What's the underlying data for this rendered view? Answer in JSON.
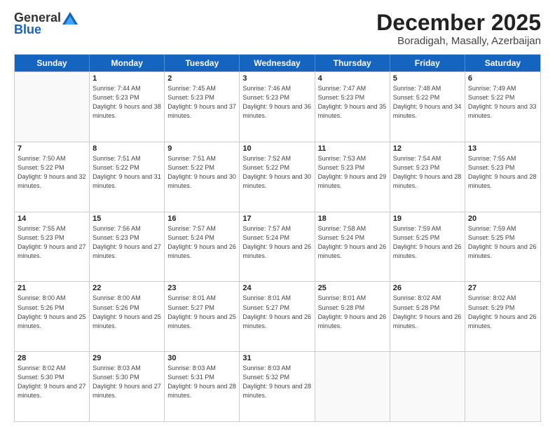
{
  "logo": {
    "general": "General",
    "blue": "Blue"
  },
  "header": {
    "month": "December 2025",
    "location": "Boradigah, Masally, Azerbaijan"
  },
  "weekdays": [
    "Sunday",
    "Monday",
    "Tuesday",
    "Wednesday",
    "Thursday",
    "Friday",
    "Saturday"
  ],
  "weeks": [
    [
      {
        "day": "",
        "empty": true
      },
      {
        "day": "1",
        "sunrise": "Sunrise: 7:44 AM",
        "sunset": "Sunset: 5:23 PM",
        "daylight": "Daylight: 9 hours and 38 minutes."
      },
      {
        "day": "2",
        "sunrise": "Sunrise: 7:45 AM",
        "sunset": "Sunset: 5:23 PM",
        "daylight": "Daylight: 9 hours and 37 minutes."
      },
      {
        "day": "3",
        "sunrise": "Sunrise: 7:46 AM",
        "sunset": "Sunset: 5:23 PM",
        "daylight": "Daylight: 9 hours and 36 minutes."
      },
      {
        "day": "4",
        "sunrise": "Sunrise: 7:47 AM",
        "sunset": "Sunset: 5:23 PM",
        "daylight": "Daylight: 9 hours and 35 minutes."
      },
      {
        "day": "5",
        "sunrise": "Sunrise: 7:48 AM",
        "sunset": "Sunset: 5:22 PM",
        "daylight": "Daylight: 9 hours and 34 minutes."
      },
      {
        "day": "6",
        "sunrise": "Sunrise: 7:49 AM",
        "sunset": "Sunset: 5:22 PM",
        "daylight": "Daylight: 9 hours and 33 minutes."
      }
    ],
    [
      {
        "day": "7",
        "sunrise": "Sunrise: 7:50 AM",
        "sunset": "Sunset: 5:22 PM",
        "daylight": "Daylight: 9 hours and 32 minutes."
      },
      {
        "day": "8",
        "sunrise": "Sunrise: 7:51 AM",
        "sunset": "Sunset: 5:22 PM",
        "daylight": "Daylight: 9 hours and 31 minutes."
      },
      {
        "day": "9",
        "sunrise": "Sunrise: 7:51 AM",
        "sunset": "Sunset: 5:22 PM",
        "daylight": "Daylight: 9 hours and 30 minutes."
      },
      {
        "day": "10",
        "sunrise": "Sunrise: 7:52 AM",
        "sunset": "Sunset: 5:22 PM",
        "daylight": "Daylight: 9 hours and 30 minutes."
      },
      {
        "day": "11",
        "sunrise": "Sunrise: 7:53 AM",
        "sunset": "Sunset: 5:23 PM",
        "daylight": "Daylight: 9 hours and 29 minutes."
      },
      {
        "day": "12",
        "sunrise": "Sunrise: 7:54 AM",
        "sunset": "Sunset: 5:23 PM",
        "daylight": "Daylight: 9 hours and 28 minutes."
      },
      {
        "day": "13",
        "sunrise": "Sunrise: 7:55 AM",
        "sunset": "Sunset: 5:23 PM",
        "daylight": "Daylight: 9 hours and 28 minutes."
      }
    ],
    [
      {
        "day": "14",
        "sunrise": "Sunrise: 7:55 AM",
        "sunset": "Sunset: 5:23 PM",
        "daylight": "Daylight: 9 hours and 27 minutes."
      },
      {
        "day": "15",
        "sunrise": "Sunrise: 7:56 AM",
        "sunset": "Sunset: 5:23 PM",
        "daylight": "Daylight: 9 hours and 27 minutes."
      },
      {
        "day": "16",
        "sunrise": "Sunrise: 7:57 AM",
        "sunset": "Sunset: 5:24 PM",
        "daylight": "Daylight: 9 hours and 26 minutes."
      },
      {
        "day": "17",
        "sunrise": "Sunrise: 7:57 AM",
        "sunset": "Sunset: 5:24 PM",
        "daylight": "Daylight: 9 hours and 26 minutes."
      },
      {
        "day": "18",
        "sunrise": "Sunrise: 7:58 AM",
        "sunset": "Sunset: 5:24 PM",
        "daylight": "Daylight: 9 hours and 26 minutes."
      },
      {
        "day": "19",
        "sunrise": "Sunrise: 7:59 AM",
        "sunset": "Sunset: 5:25 PM",
        "daylight": "Daylight: 9 hours and 26 minutes."
      },
      {
        "day": "20",
        "sunrise": "Sunrise: 7:59 AM",
        "sunset": "Sunset: 5:25 PM",
        "daylight": "Daylight: 9 hours and 26 minutes."
      }
    ],
    [
      {
        "day": "21",
        "sunrise": "Sunrise: 8:00 AM",
        "sunset": "Sunset: 5:26 PM",
        "daylight": "Daylight: 9 hours and 25 minutes."
      },
      {
        "day": "22",
        "sunrise": "Sunrise: 8:00 AM",
        "sunset": "Sunset: 5:26 PM",
        "daylight": "Daylight: 9 hours and 25 minutes."
      },
      {
        "day": "23",
        "sunrise": "Sunrise: 8:01 AM",
        "sunset": "Sunset: 5:27 PM",
        "daylight": "Daylight: 9 hours and 25 minutes."
      },
      {
        "day": "24",
        "sunrise": "Sunrise: 8:01 AM",
        "sunset": "Sunset: 5:27 PM",
        "daylight": "Daylight: 9 hours and 26 minutes."
      },
      {
        "day": "25",
        "sunrise": "Sunrise: 8:01 AM",
        "sunset": "Sunset: 5:28 PM",
        "daylight": "Daylight: 9 hours and 26 minutes."
      },
      {
        "day": "26",
        "sunrise": "Sunrise: 8:02 AM",
        "sunset": "Sunset: 5:28 PM",
        "daylight": "Daylight: 9 hours and 26 minutes."
      },
      {
        "day": "27",
        "sunrise": "Sunrise: 8:02 AM",
        "sunset": "Sunset: 5:29 PM",
        "daylight": "Daylight: 9 hours and 26 minutes."
      }
    ],
    [
      {
        "day": "28",
        "sunrise": "Sunrise: 8:02 AM",
        "sunset": "Sunset: 5:30 PM",
        "daylight": "Daylight: 9 hours and 27 minutes."
      },
      {
        "day": "29",
        "sunrise": "Sunrise: 8:03 AM",
        "sunset": "Sunset: 5:30 PM",
        "daylight": "Daylight: 9 hours and 27 minutes."
      },
      {
        "day": "30",
        "sunrise": "Sunrise: 8:03 AM",
        "sunset": "Sunset: 5:31 PM",
        "daylight": "Daylight: 9 hours and 28 minutes."
      },
      {
        "day": "31",
        "sunrise": "Sunrise: 8:03 AM",
        "sunset": "Sunset: 5:32 PM",
        "daylight": "Daylight: 9 hours and 28 minutes."
      },
      {
        "day": "",
        "empty": true
      },
      {
        "day": "",
        "empty": true
      },
      {
        "day": "",
        "empty": true
      }
    ]
  ]
}
